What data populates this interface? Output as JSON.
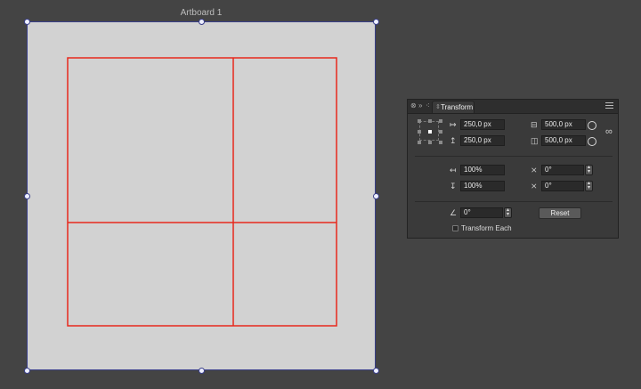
{
  "artboard": {
    "title": "Artboard 1"
  },
  "colors": {
    "workspace": "#444444",
    "artboard_fill": "#d2d2d2",
    "artboard_border": "#3a3f8a",
    "frame_stroke": "#e8291c"
  },
  "panel": {
    "tab_label": "Transform",
    "header_icons": [
      "close-icon",
      "collapse-icon",
      "grip-icon",
      "menu-icon"
    ],
    "position": {
      "x_value": "250,0 px",
      "y_value": "250,0 px",
      "x_icon": "arrow-right-icon",
      "y_icon": "arrow-up-icon"
    },
    "size": {
      "width_value": "500,0 px",
      "height_value": "500,0 px",
      "link_icon": "chain-link-icon"
    },
    "scale": {
      "horizontal_value": "100%",
      "vertical_value": "100%"
    },
    "shear": {
      "horizontal_value": "0°",
      "vertical_value": "0°"
    },
    "rotation": {
      "value": "0°",
      "icon": "angle-icon"
    },
    "reset_label": "Reset",
    "transform_each_label": "Transform Each",
    "transform_each_checked": false
  }
}
